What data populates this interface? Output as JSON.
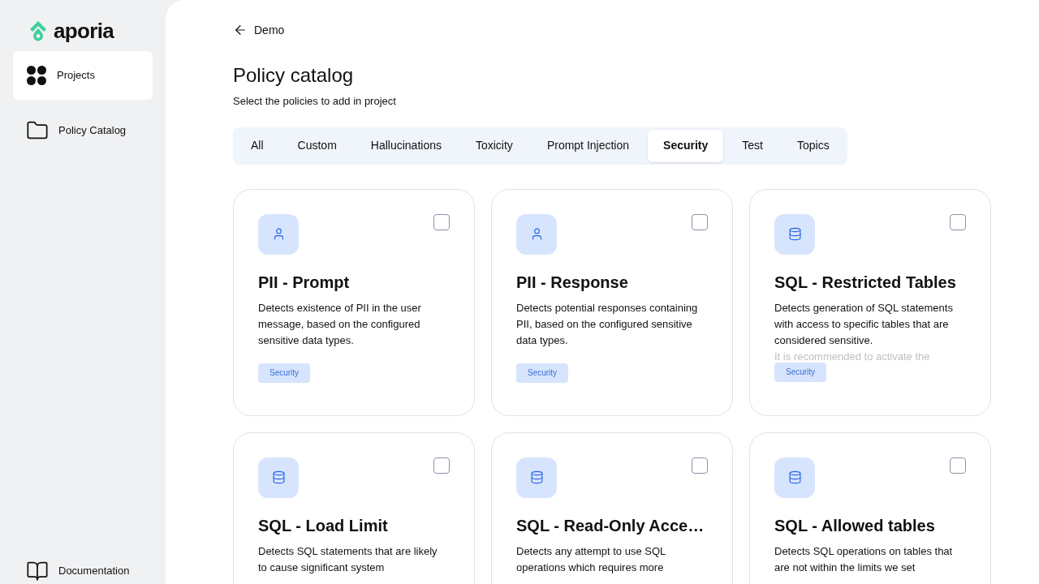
{
  "sidebar": {
    "logo": "aporia",
    "items": [
      {
        "label": "Projects",
        "kind": "grid",
        "selected": true
      },
      {
        "label": "Policy Catalog",
        "kind": "folder",
        "selected": false
      }
    ],
    "footer": {
      "label": "Documentation"
    }
  },
  "back_link": "Demo",
  "title": "Policy catalog",
  "subtitle": "Select the policies to add in project",
  "tabs": [
    {
      "label": "All",
      "selected": false
    },
    {
      "label": "Custom",
      "selected": false
    },
    {
      "label": "Hallucinations",
      "selected": false
    },
    {
      "label": "Toxicity",
      "selected": false
    },
    {
      "label": "Prompt Injection",
      "selected": false
    },
    {
      "label": "Security",
      "selected": true
    },
    {
      "label": "Test",
      "selected": false
    },
    {
      "label": "Topics",
      "selected": false
    }
  ],
  "cards": [
    {
      "kind": "user",
      "title": "PII - Prompt",
      "description": "Detects existence of PII in the user message, based on the configured sensitive data types.",
      "tag": "Security",
      "checked": false
    },
    {
      "kind": "user",
      "title": "PII - Response",
      "description": "Detects potential responses containing PII, based on the configured sensitive data types.",
      "tag": "Security",
      "checked": false
    },
    {
      "kind": "database",
      "title": "SQL - Restricted Tables",
      "description": "Detects generation of SQL statements with access to specific tables that are considered sensitive.",
      "faded_line": "It is recommended to activate the",
      "tag": "Security",
      "checked": false
    },
    {
      "kind": "database",
      "title": "SQL - Load Limit",
      "description": "Detects SQL statements that are likely to cause significant system",
      "checked": false
    },
    {
      "kind": "database",
      "title": "SQL - Read-Only Acce…",
      "description": "Detects any attempt to use SQL operations which requires more",
      "checked": false
    },
    {
      "kind": "database",
      "title": "SQL - Allowed tables",
      "description": "Detects SQL operations on tables that are not within the limits we set",
      "checked": false
    }
  ]
}
